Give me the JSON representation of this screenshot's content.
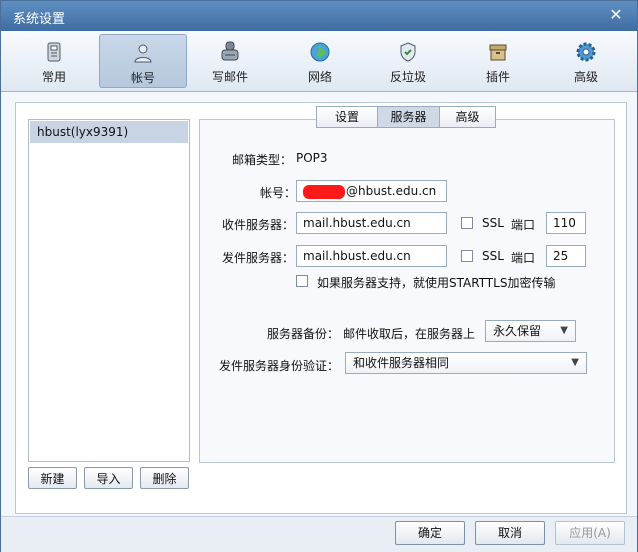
{
  "window": {
    "title": "系统设置",
    "close_glyph": "✕"
  },
  "toolbar": {
    "items": [
      {
        "label": "常用",
        "icon": "general-icon"
      },
      {
        "label": "帐号",
        "icon": "account-icon"
      },
      {
        "label": "写邮件",
        "icon": "compose-icon"
      },
      {
        "label": "网络",
        "icon": "network-icon"
      },
      {
        "label": "反垃圾",
        "icon": "antispam-icon"
      },
      {
        "label": "插件",
        "icon": "plugin-icon"
      },
      {
        "label": "高级",
        "icon": "advanced-icon"
      }
    ],
    "active_index": 1
  },
  "accounts": {
    "items": [
      {
        "label": "hbust(lyx9391)"
      }
    ],
    "new_label": "新建",
    "import_label": "导入",
    "delete_label": "删除"
  },
  "tabs": {
    "items": [
      {
        "label": "设置"
      },
      {
        "label": "服务器"
      },
      {
        "label": "高级"
      }
    ],
    "active_index": 1
  },
  "server": {
    "mailbox_type_label": "邮箱类型：",
    "mailbox_type_value": "POP3",
    "account_label": "帐号：",
    "account_value_suffix": "@hbust.edu.cn",
    "incoming_label": "收件服务器：",
    "incoming_value": "mail.hbust.edu.cn",
    "outgoing_label": "发件服务器：",
    "outgoing_value": "mail.hbust.edu.cn",
    "ssl_label": "SSL",
    "port_label": "端口",
    "incoming_port": "110",
    "outgoing_port": "25",
    "starttls_label": "如果服务器支持，就使用STARTTLS加密传输",
    "backup_label": "服务器备份：",
    "backup_desc": "邮件收取后，在服务器上",
    "backup_value": "永久保留",
    "auth_label": "发件服务器身份验证：",
    "auth_value": "和收件服务器相同"
  },
  "footer": {
    "ok_label": "确定",
    "cancel_label": "取消",
    "apply_label": "应用(A)"
  },
  "colors": {
    "titlebar": "#4f7fb4",
    "active_tool": "#c2d2e6",
    "redaction": "#ff1a1a"
  }
}
